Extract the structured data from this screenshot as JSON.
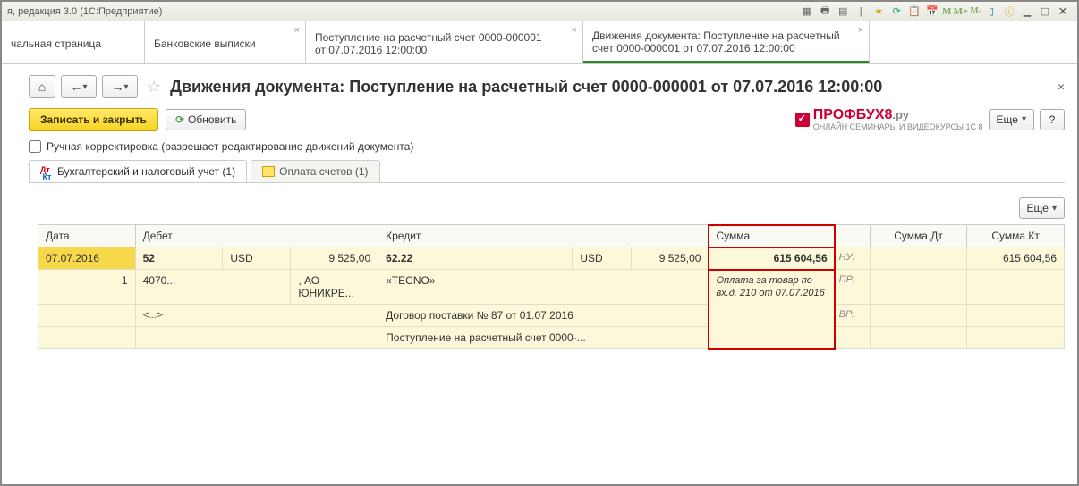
{
  "window": {
    "title": "я, редакция 3.0  (1С:Предприятие)"
  },
  "app_tabs": {
    "t0": "чальная страница",
    "t1": "Банковские выписки",
    "t2_l1": "Поступление на расчетный счет 0000-000001",
    "t2_l2": "от 07.07.2016 12:00:00",
    "t3_l1": "Движения документа: Поступление на расчетный",
    "t3_l2": "счет 0000-000001 от 07.07.2016 12:00:00"
  },
  "page": {
    "title": "Движения документа: Поступление на расчетный счет 0000-000001 от 07.07.2016 12:00:00",
    "save_close": "Записать и закрыть",
    "refresh": "Обновить",
    "more": "Еще",
    "help": "?",
    "manual_edit": "Ручная корректировка (разрешает редактирование движений документа)"
  },
  "logo": {
    "main": "ПРОФБУХ8",
    "suf": ".ру",
    "tagline": "ОНЛАЙН СЕМИНАРЫ И ВИДЕОКУРСЫ 1С 8"
  },
  "inner_tabs": {
    "t1": "Бухгалтерский и налоговый учет (1)",
    "t2": "Оплата счетов (1)"
  },
  "grid": {
    "headers": {
      "date": "Дата",
      "debit": "Дебет",
      "credit": "Кредит",
      "sum": "Сумма",
      "sumdt": "Сумма Дт",
      "sumkt": "Сумма Кт"
    },
    "row1": {
      "date": "07.07.2016",
      "debit_acc": "52",
      "debit_cur": "USD",
      "debit_amt": "9 525,00",
      "credit_acc": "62.22",
      "credit_cur": "USD",
      "credit_amt": "9 525,00",
      "sum": "615 604,56",
      "nu": "НУ:",
      "sumkt": "615 604,56"
    },
    "row2": {
      "n": "1",
      "debit_sub1": "4070...",
      "debit_sub2": ", АО ЮНИКРЕ...",
      "credit_sub1": "«TECNO»",
      "desc": "Оплата за товар по вх.д. 210 от 07.07.2016",
      "pr": "ПР:"
    },
    "row3": {
      "debit_sub": "<...>",
      "credit_sub": "Договор поставки № 87 от 01.07.2016",
      "vr": "ВР:"
    },
    "row4": {
      "credit_sub": "Поступление на расчетный счет 0000-..."
    }
  }
}
